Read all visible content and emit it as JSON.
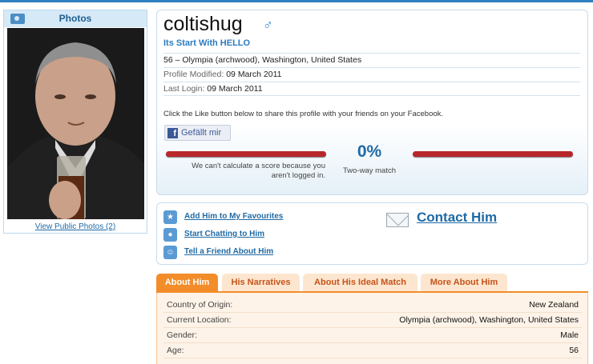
{
  "photos": {
    "title": "Photos",
    "view_link": "View Public Photos (2)"
  },
  "profile": {
    "username": "coltishug",
    "gender_symbol": "♂",
    "tagline": "Its Start With HELLO",
    "summary": "56 – Olympia (archwood), Washington, United States",
    "modified_label": "Profile Modified:",
    "modified_value": "09 March 2011",
    "login_label": "Last Login:",
    "login_value": "09 March 2011",
    "fb_text": "Click the Like button below to share this profile with your friends on your Facebook.",
    "like_label": "Gefällt mir",
    "match_pct": "0%",
    "match_label": "Two-way match",
    "no_score_text": "We can't calculate a score because you aren't logged in.",
    "match_bar_color": "#b8262b"
  },
  "actions": {
    "favourites": "Add Him to My Favourites",
    "chat": "Start Chatting to Him",
    "tell_friend": "Tell a Friend About Him",
    "contact": "Contact Him"
  },
  "tabs": [
    {
      "label": "About Him",
      "active": true
    },
    {
      "label": "His Narratives",
      "active": false
    },
    {
      "label": "About His Ideal Match",
      "active": false
    },
    {
      "label": "More About Him",
      "active": false
    }
  ],
  "details": [
    {
      "key": "Country of Origin:",
      "value": "New Zealand"
    },
    {
      "key": "Current Location:",
      "value": "Olympia (archwood), Washington, United States"
    },
    {
      "key": "Gender:",
      "value": "Male"
    },
    {
      "key": "Age:",
      "value": "56"
    }
  ],
  "colors": {
    "accent_blue": "#1f6aa5",
    "tab_orange": "#f28d2a"
  }
}
